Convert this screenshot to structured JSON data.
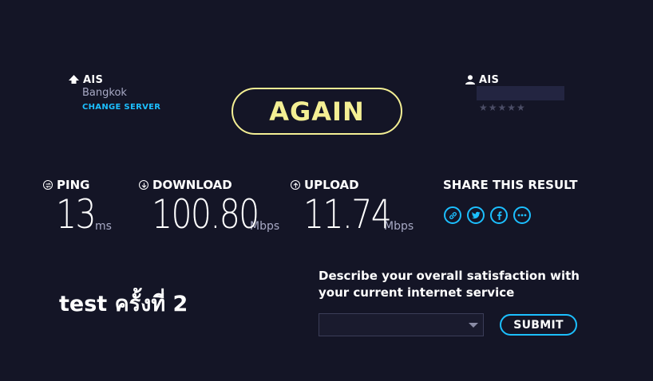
{
  "server": {
    "isp_name": "AIS",
    "location": "Bangkok",
    "change_label": "CHANGE SERVER"
  },
  "client": {
    "isp_name": "AIS",
    "rating_stars": "★★★★★"
  },
  "again_label": "AGAIN",
  "metrics": {
    "ping": {
      "label": "PING",
      "value": "13",
      "unit": "ms"
    },
    "download": {
      "label": "DOWNLOAD",
      "value": "100.80",
      "unit": "Mbps"
    },
    "upload": {
      "label": "UPLOAD",
      "value": "11.74",
      "unit": "Mbps"
    }
  },
  "share": {
    "title": "SHARE THIS RESULT",
    "icons": [
      "link-icon",
      "twitter-icon",
      "facebook-icon",
      "more-icon"
    ]
  },
  "test_label": "test ครั้งที่ 2",
  "satisfaction": {
    "question_line1": "Describe your overall satisfaction with",
    "question_line2": "your current internet service",
    "select_value": "",
    "submit_label": "SUBMIT"
  },
  "colors": {
    "background": "#141526",
    "accent_yellow": "#f4ef94",
    "accent_blue": "#1cbfff",
    "muted_text": "#a7a9c4"
  }
}
